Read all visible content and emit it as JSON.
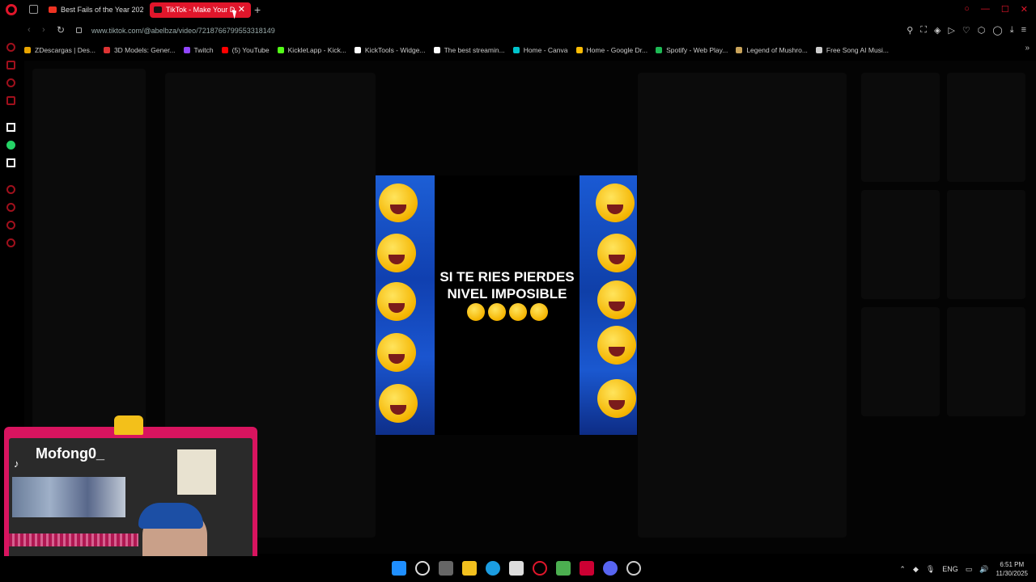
{
  "browser": {
    "tabs": [
      {
        "title": "Best Fails of the Year 202",
        "active": false
      },
      {
        "title": "TikTok - Make Your D",
        "active": true
      }
    ],
    "url": "www.tiktok.com/@abelbza/video/7218766799553318149",
    "bookmarks": [
      {
        "label": "ZDescargas | Des...",
        "color": "#e8a400"
      },
      {
        "label": "3D Models: Gener...",
        "color": "#d33"
      },
      {
        "label": "Twitch",
        "color": "#9146ff"
      },
      {
        "label": "(5) YouTube",
        "color": "#f00"
      },
      {
        "label": "Kicklet.app - Kick...",
        "color": "#53fc18"
      },
      {
        "label": "KickTools - Widge...",
        "color": "#fff"
      },
      {
        "label": "The best streamin...",
        "color": "#fff"
      },
      {
        "label": "Home - Canva",
        "color": "#00c4cc"
      },
      {
        "label": "Home - Google Dr...",
        "color": "#fbbc04"
      },
      {
        "label": "Spotify - Web Play...",
        "color": "#1db954"
      },
      {
        "label": "Legend of Mushro...",
        "color": "#c9a35a"
      },
      {
        "label": "Free Song AI Musi...",
        "color": "#ccc"
      }
    ]
  },
  "video": {
    "line1": "SI TE RIES  PIERDES",
    "line2": "NIVEL IMPOSIBLE"
  },
  "webcam": {
    "name": "Mofong0_",
    "platform_icon": "tiktok-icon"
  },
  "taskbar": {
    "language": "ENG",
    "time": "6:51 PM",
    "date": "11/30/2025"
  },
  "colors": {
    "accent": "#e0162b",
    "webcam_frame": "#d8145f"
  }
}
